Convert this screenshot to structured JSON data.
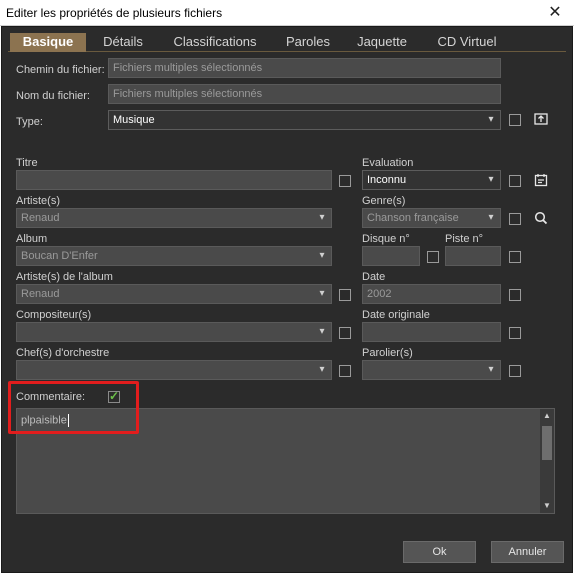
{
  "window": {
    "title": "Editer les propriétés de plusieurs fichiers",
    "close_glyph": "✕"
  },
  "tabs": [
    {
      "label": "Basique",
      "active": true
    },
    {
      "label": "Détails"
    },
    {
      "label": "Classifications"
    },
    {
      "label": "Paroles"
    },
    {
      "label": "Jaquette"
    },
    {
      "label": "CD Virtuel"
    }
  ],
  "fields": {
    "chemin_label": "Chemin du fichier:",
    "chemin_value": "Fichiers multiples sélectionnés",
    "nom_label": "Nom du fichier:",
    "nom_value": "Fichiers multiples sélectionnés",
    "type_label": "Type:",
    "type_value": "Musique",
    "titre_label": "Titre",
    "titre_value": "",
    "evaluation_label": "Evaluation",
    "evaluation_value": "Inconnu",
    "artiste_label": "Artiste(s)",
    "artiste_value": "Renaud",
    "genre_label": "Genre(s)",
    "genre_value": "Chanson française",
    "album_label": "Album",
    "album_value": "Boucan D'Enfer",
    "disque_label": "Disque n°",
    "disque_value": "",
    "piste_label": "Piste n°",
    "piste_value": "",
    "artiste_album_label": "Artiste(s) de l'album",
    "artiste_album_value": "Renaud",
    "date_label": "Date",
    "date_value": "2002",
    "compositeur_label": "Compositeur(s)",
    "compositeur_value": "",
    "date_originale_label": "Date originale",
    "date_originale_value": "",
    "chef_label": "Chef(s) d'orchestre",
    "chef_value": "",
    "parolier_label": "Parolier(s)",
    "parolier_value": "",
    "commentaire_label": "Commentaire:",
    "commentaire_value": "plpaisible",
    "commentaire_checked": true
  },
  "icons": {
    "type_side": "export-icon",
    "evaluation_side": "calendar-icon",
    "genre_side": "search-icon",
    "chevron": "▾",
    "scroll_up": "▲",
    "scroll_down": "▼"
  },
  "buttons": {
    "ok": "Ok",
    "cancel": "Annuler"
  },
  "colors": {
    "accent_tab": "#8c7350",
    "highlight": "#e21d1d",
    "check": "#6cc04a"
  }
}
